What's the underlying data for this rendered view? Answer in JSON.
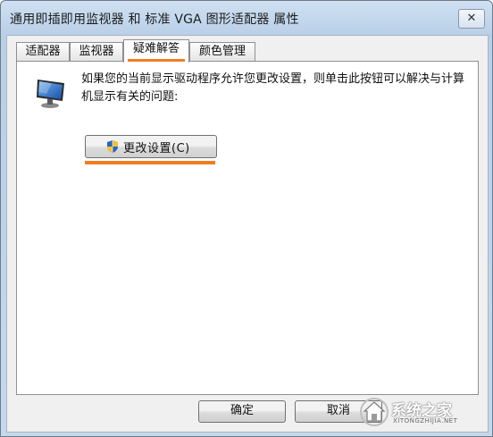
{
  "window": {
    "title": "通用即插即用监视器 和 标准 VGA 图形适配器 属性",
    "close_label": "✕"
  },
  "tabs": [
    {
      "label": "适配器"
    },
    {
      "label": "监视器"
    },
    {
      "label": "疑难解答",
      "active": true
    },
    {
      "label": "颜色管理"
    }
  ],
  "panel": {
    "description": "如果您的当前显示驱动程序允许您更改设置，则单击此按钮可以解决与计算机显示有关的问题:",
    "change_button_label": "更改设置(C)"
  },
  "footer": {
    "ok_label": "确定",
    "cancel_label": "取消"
  },
  "watermark": {
    "text": "系统之家",
    "url": "XITONGZHIJIA.NET"
  },
  "colors": {
    "highlight": "#f07d22"
  }
}
